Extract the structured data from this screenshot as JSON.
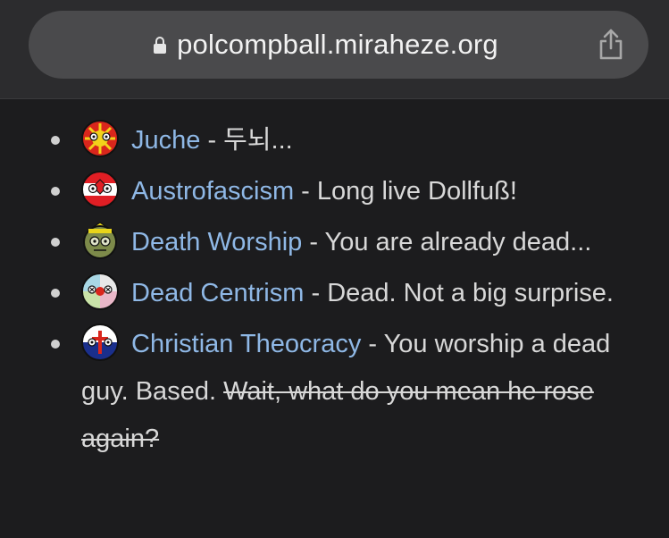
{
  "browser": {
    "url": "polcompball.miraheze.org",
    "lock_icon": "lock-icon",
    "share_icon": "share-icon"
  },
  "items": [
    {
      "link": "Juche",
      "sep": " - ",
      "text": "두뇌...",
      "strike": "",
      "icon": "juche-ball-icon"
    },
    {
      "link": "Austrofascism",
      "sep": " - ",
      "text": "Long live Dollfuß!",
      "strike": "",
      "icon": "austrofascism-ball-icon"
    },
    {
      "link": "Death Worship",
      "sep": " - ",
      "text": "You are already dead...",
      "strike": "",
      "icon": "death-worship-ball-icon"
    },
    {
      "link": "Dead Centrism",
      "sep": " - ",
      "text": "Dead. Not a big surprise.",
      "strike": "",
      "icon": "dead-centrism-ball-icon"
    },
    {
      "link": "Christian Theocracy",
      "sep": " - ",
      "text": "You worship a dead guy. Based. ",
      "strike": "Wait, what do you mean he rose again?",
      "icon": "christian-theocracy-ball-icon"
    }
  ],
  "colors": {
    "background": "#1c1c1e",
    "link": "#8fb8e6",
    "text": "#d8d8d8"
  }
}
